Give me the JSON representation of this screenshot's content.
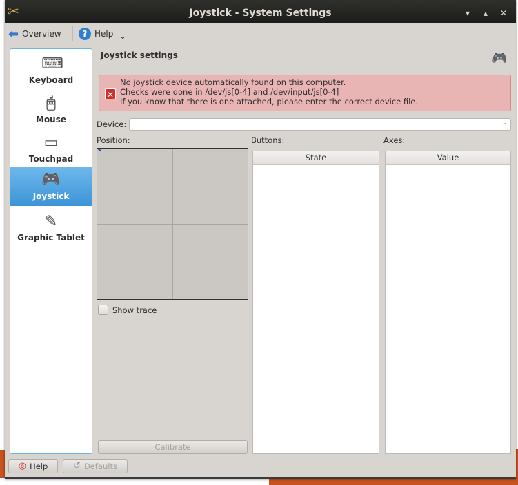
{
  "window": {
    "title": "Joystick - System Settings"
  },
  "toolbar": {
    "overview": "Overview",
    "help": "Help",
    "more": "⌄"
  },
  "sidebar": {
    "items": [
      {
        "label": "Keyboard",
        "icon": "keyboard-icon",
        "glyph": "⌨"
      },
      {
        "label": "Mouse",
        "icon": "mouse-icon",
        "glyph": "🖱"
      },
      {
        "label": "Touchpad",
        "icon": "touchpad-icon",
        "glyph": "▭"
      },
      {
        "label": "Joystick",
        "icon": "joystick-icon",
        "glyph": "🎮"
      },
      {
        "label": "Graphic Tablet",
        "icon": "graphic-tablet-icon",
        "glyph": "✎"
      }
    ]
  },
  "main": {
    "heading": "Joystick settings",
    "error": [
      "No joystick device automatically found on this computer.",
      "Checks were done in /dev/js[0-4] and /dev/input/js[0-4]",
      "If you know that there is one attached, please enter the correct device file."
    ],
    "device_label": "Device:",
    "device_value": "",
    "position_label": "Position:",
    "show_trace": "Show trace",
    "buttons_label": "Buttons:",
    "buttons_header": "State",
    "axes_label": "Axes:",
    "axes_header": "Value",
    "calibrate": "Calibrate"
  },
  "footer": {
    "help": "Help",
    "defaults": "Defaults"
  },
  "colors": {
    "selected": "#3d94d6",
    "error_bg": "#e9b4b4"
  }
}
